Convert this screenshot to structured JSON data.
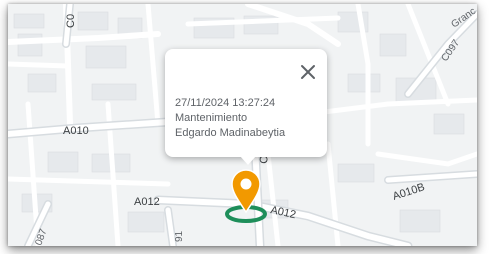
{
  "map": {
    "roads": [
      {
        "label": "A010"
      },
      {
        "label": "A012"
      },
      {
        "label": "A012"
      },
      {
        "label": "A010B"
      },
      {
        "label": "C097"
      },
      {
        "label": "C0"
      },
      {
        "label": "C0"
      },
      {
        "label": "087"
      },
      {
        "label": "91"
      },
      {
        "label": "Granc"
      }
    ]
  },
  "popup": {
    "datetime": "27/11/2024 13:27:24",
    "type": "Mantenimiento",
    "person": "Edgardo Madinabeytia",
    "close_icon": "close-icon"
  },
  "marker": {
    "icon": "map-pin-icon",
    "pin_color": "#f29900",
    "ring_color": "#1e8e5a"
  },
  "colors": {
    "map_background": "#f1f3f4",
    "road": "#ffffff",
    "main_road": "#dde1e5",
    "block": "#e4e7ea"
  }
}
